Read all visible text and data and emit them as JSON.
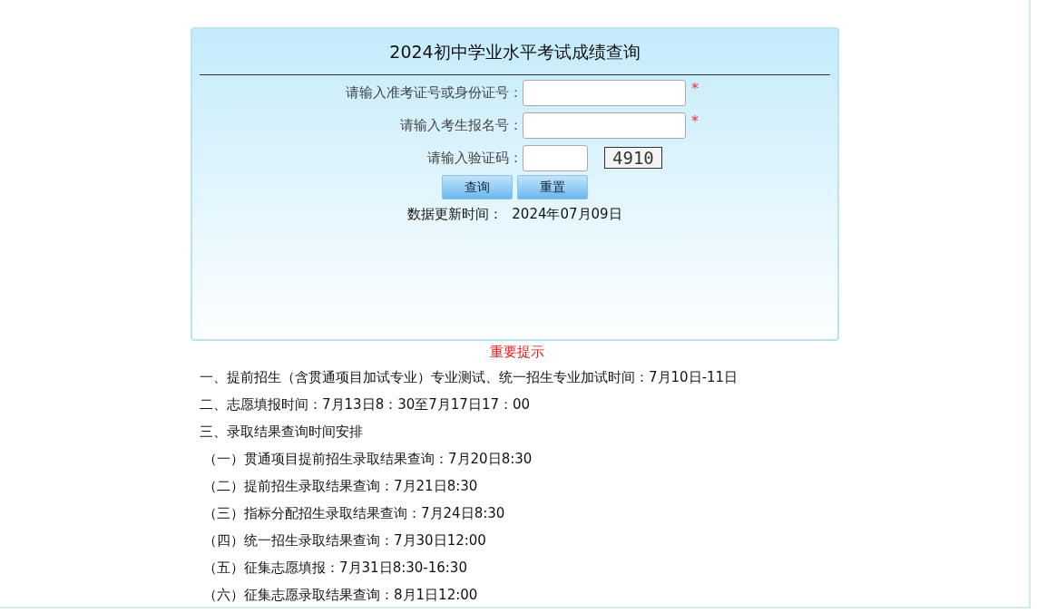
{
  "panel": {
    "title": "2024初中学业水平考试成绩查询",
    "fields": [
      {
        "label": "请输入准考证号或身份证号：",
        "required": true,
        "kind": "text"
      },
      {
        "label": "请输入考生报名号：",
        "required": true,
        "kind": "text"
      },
      {
        "label": "请输入验证码：",
        "required": false,
        "kind": "captcha",
        "captcha": "4910"
      }
    ],
    "required_mark": "*",
    "buttons": [
      "查询",
      "重置"
    ],
    "update_label": "数据更新时间：",
    "update_date": "2024年07月09日"
  },
  "notice": {
    "title": "重要提示",
    "lines": [
      {
        "text": "一、提前招生（含贯通项目加试专业）专业测试、统一招生专业加试时间：7月10日-11日",
        "kind": "main"
      },
      {
        "text": "二、志愿填报时间：7月13日8：30至7月17日17：00",
        "kind": "main"
      },
      {
        "text": "三、录取结果查询时间安排",
        "kind": "main"
      },
      {
        "text": "（一）贯通项目提前招生录取结果查询：7月20日8:30",
        "kind": "sub"
      },
      {
        "text": "（二）提前招生录取结果查询：7月21日8:30",
        "kind": "sub"
      },
      {
        "text": "（三）指标分配招生录取结果查询：7月24日8:30",
        "kind": "sub"
      },
      {
        "text": "（四）统一招生录取结果查询：7月30日12:00",
        "kind": "sub"
      },
      {
        "text": "（五）征集志愿填报：7月31日8:30-16:30",
        "kind": "sub"
      },
      {
        "text": "（六）征集志愿录取结果查询：8月1日12:00",
        "kind": "sub"
      }
    ]
  }
}
